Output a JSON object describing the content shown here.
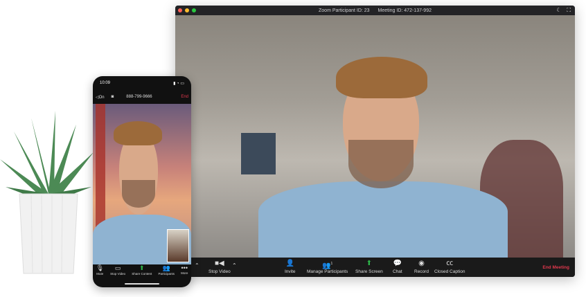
{
  "desktop": {
    "title_participant": "Zoom Participant ID: 23",
    "title_meeting": "Meeting ID: 472-137-992",
    "toolbar": {
      "stop_video": "Stop Video",
      "invite": "Invite",
      "manage_participants": "Manage Participants",
      "participant_count": "1",
      "share_screen": "Share Screen",
      "chat": "Chat",
      "record": "Record",
      "closed_caption": "Closed Caption",
      "end_meeting": "End Meeting"
    }
  },
  "phone": {
    "time": "10:09",
    "speaker_label": "On",
    "phone_number": "888-799-9666",
    "end": "End",
    "toolbar": {
      "mute": "Mute",
      "stop_video": "Stop Video",
      "share_content": "Share Content",
      "participants": "Participants",
      "more": "More"
    }
  },
  "colors": {
    "end_red": "#e0374c",
    "share_green": "#2db84a"
  }
}
